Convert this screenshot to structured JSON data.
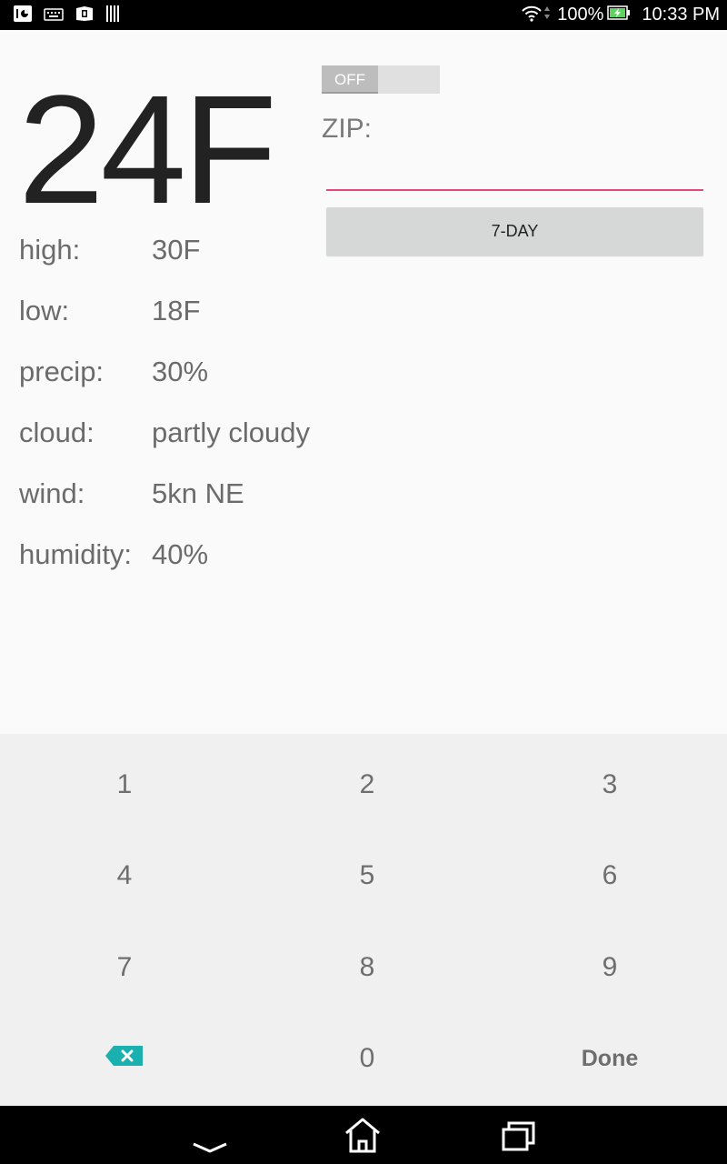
{
  "status_bar": {
    "left_icons": [
      "usb-debug-icon",
      "keyboard-icon",
      "shop-icon",
      "barcode-icon"
    ],
    "wifi_icon": "wifi-icon",
    "battery_percent": "100%",
    "battery_icon": "battery-charging-icon",
    "time": "10:33 PM"
  },
  "weather": {
    "current_temp": "24F",
    "details": [
      {
        "label": "high:",
        "value": "30F"
      },
      {
        "label": "low:",
        "value": "18F"
      },
      {
        "label": "precip:",
        "value": "30%"
      },
      {
        "label": "cloud:",
        "value": "partly cloudy"
      },
      {
        "label": "wind:",
        "value": "5kn NE"
      },
      {
        "label": "humidity:",
        "value": "40%"
      }
    ]
  },
  "controls": {
    "toggle_label": "OFF",
    "zip_label": "ZIP:",
    "zip_value": "",
    "sevenday_label": "7-DAY"
  },
  "keypad": {
    "keys": [
      "1",
      "2",
      "3",
      "4",
      "5",
      "6",
      "7",
      "8",
      "9"
    ],
    "zero": "0",
    "done": "Done",
    "delete_icon": "backspace-icon"
  },
  "nav_bar": {
    "icons": [
      "back-icon",
      "home-icon",
      "recents-icon"
    ]
  },
  "colors": {
    "accent": "#e8457a",
    "backspace": "#1ab0b0"
  }
}
